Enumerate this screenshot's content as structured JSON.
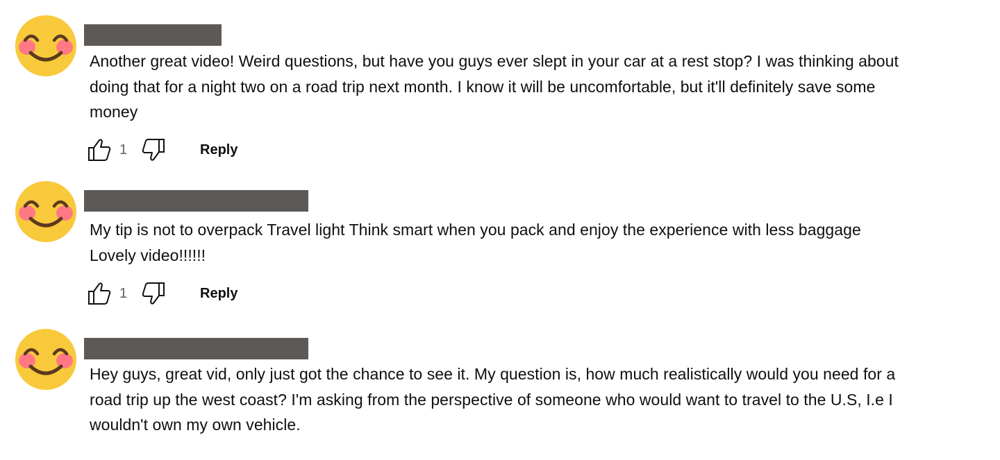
{
  "comments": [
    {
      "text": "Another great video! Weird questions, but have you guys ever slept in your car at a rest stop? I was thinking about\ndoing that for a night two on a road trip next month. I know it will be uncomfortable, but it'll definitely save some\nmoney",
      "like_count": "1",
      "reply_label": "Reply",
      "avatar_icon": "smiling-face-with-blush-icon"
    },
    {
      "text": "My tip is not to overpack Travel light Think smart when you pack and enjoy the experience with less baggage\nLovely video!!!!!!",
      "like_count": "1",
      "reply_label": "Reply",
      "avatar_icon": "smiling-face-with-blush-icon"
    },
    {
      "text": "Hey guys, great vid, only just got the chance to see it. My question is, how much realistically would you need for a\nroad trip up the west coast? I'm asking from the perspective of someone who would want to travel to the U.S, I.e I\nwouldn't own my own vehicle.",
      "avatar_icon": "smiling-face-with-blush-icon"
    }
  ],
  "icons": {
    "like": "thumbs-up-icon",
    "dislike": "thumbs-down-icon"
  },
  "colors": {
    "redaction": "#5c5957",
    "emoji_face": "#f9c93c",
    "emoji_blush": "#ff6f8c",
    "text": "#0f0f0f",
    "like_count": "#606060"
  }
}
